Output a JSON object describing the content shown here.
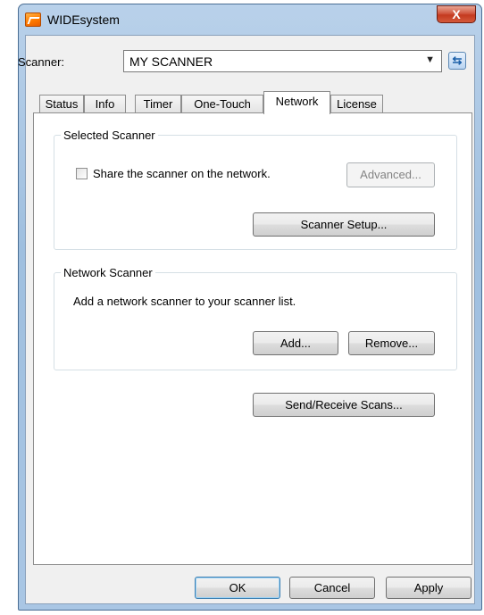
{
  "window": {
    "title": "WIDEsystem",
    "close_label": "X"
  },
  "scanner": {
    "label": "Scanner:",
    "selected": "MY SCANNER"
  },
  "tabs": [
    {
      "label": "Status"
    },
    {
      "label": "Info"
    },
    {
      "label": "Timer"
    },
    {
      "label": "One-Touch"
    },
    {
      "label": "Network",
      "active": true
    },
    {
      "label": "License"
    }
  ],
  "selected_scanner": {
    "legend": "Selected Scanner",
    "share_label": "Share the scanner on the network.",
    "share_checked": false,
    "advanced_label": "Advanced...",
    "setup_label": "Scanner Setup..."
  },
  "network_scanner": {
    "legend": "Network Scanner",
    "description": "Add a network scanner to your scanner list.",
    "add_label": "Add...",
    "remove_label": "Remove..."
  },
  "send_receive_label": "Send/Receive Scans...",
  "footer": {
    "ok": "OK",
    "cancel": "Cancel",
    "apply": "Apply"
  },
  "icons": {
    "app": "widesystem-app-icon",
    "refresh": "refresh-icon",
    "dropdown": "chevron-down-icon"
  }
}
